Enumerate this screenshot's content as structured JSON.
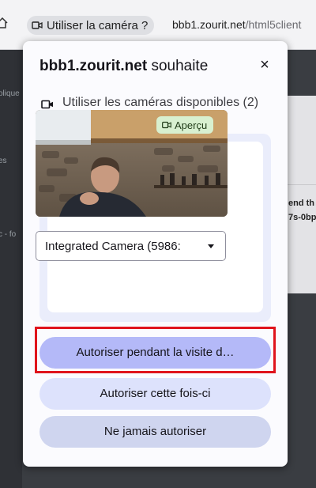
{
  "browser": {
    "permission_chip_label": "Utiliser la caméra ?",
    "url_domain": "bbb1.zourit.net",
    "url_path": "/html5client"
  },
  "background": {
    "left_texts": [
      "olique",
      "es",
      "c - fo"
    ],
    "right_texts": [
      "end th",
      "7s-0bp"
    ]
  },
  "popup": {
    "site": "bbb1.zourit.net",
    "title_suffix": "souhaite",
    "close_label": "×",
    "permission_text": "Utiliser les caméras disponibles (2)",
    "preview_label": "Aperçu",
    "camera_select_value": "Integrated Camera (5986:",
    "buttons": {
      "allow_visit": "Autoriser pendant la visite d…",
      "allow_once": "Autoriser cette fois-ci",
      "never": "Ne jamais autoriser"
    }
  },
  "icons": {
    "camera": "camera-icon",
    "home": "home-icon",
    "close": "close-icon",
    "dropdown": "chevron-down-icon"
  },
  "colors": {
    "primary_button": "#b4b9f8",
    "secondary_button": "#dde2fc",
    "tertiary_button": "#cfd5ef",
    "highlight": "#e0141c",
    "preview_badge": "#d8f0d0"
  }
}
